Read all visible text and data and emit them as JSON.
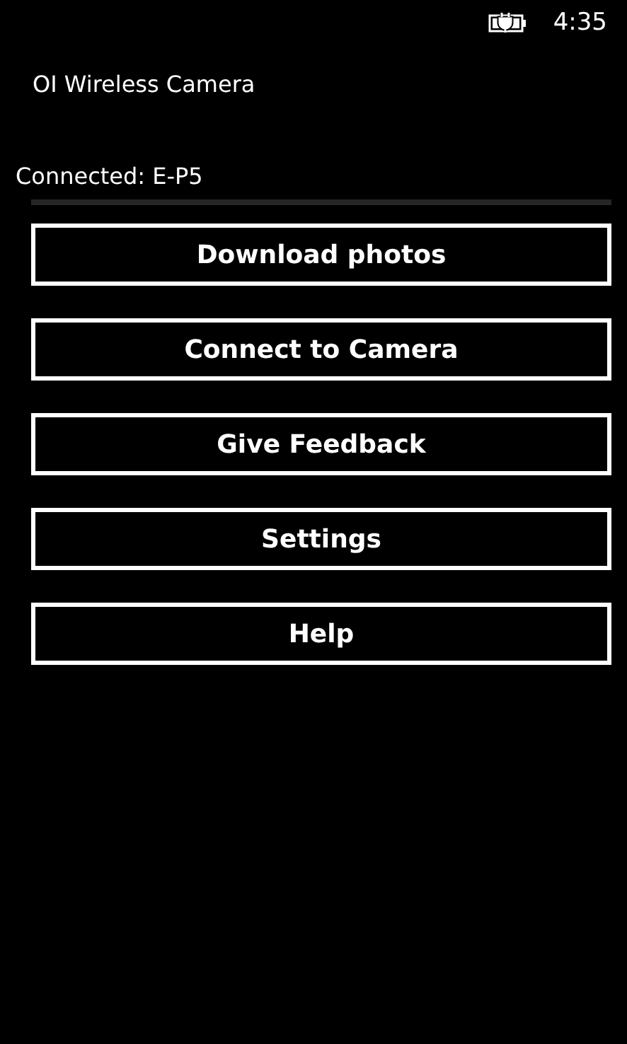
{
  "status_bar": {
    "time": "4:35"
  },
  "app_title": "OI Wireless Camera",
  "connection_status": "Connected: E-P5",
  "buttons": [
    "Download photos",
    "Connect to Camera",
    "Give Feedback",
    "Settings",
    "Help"
  ]
}
